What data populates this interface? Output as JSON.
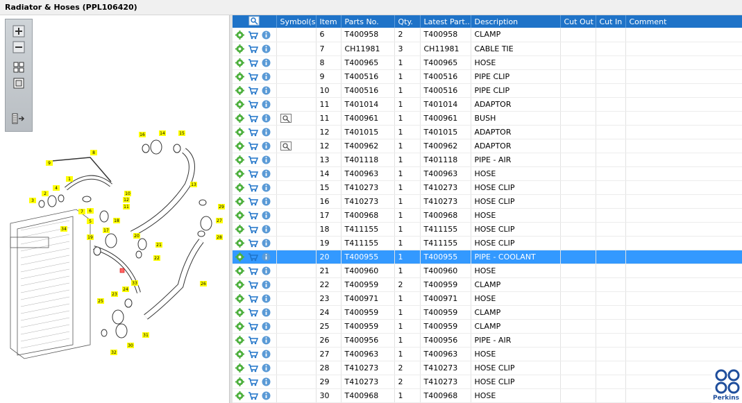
{
  "window": {
    "title": "Radiator & Hoses (PPL106420)"
  },
  "toolbar": {
    "items": [
      {
        "name": "zoom-in-button",
        "icon": "zoom-in-icon"
      },
      {
        "name": "zoom-out-button",
        "icon": "zoom-out-icon"
      },
      {
        "name": "fit-all-button",
        "icon": "fit-all-icon"
      },
      {
        "name": "fit-window-button",
        "icon": "fit-window-icon"
      },
      {
        "name": "export-button",
        "icon": "export-list-icon"
      }
    ]
  },
  "diagram": {
    "callouts": [
      "1",
      "2",
      "3",
      "4",
      "5",
      "6",
      "7",
      "8",
      "9",
      "10",
      "11",
      "12",
      "13",
      "14",
      "15",
      "16",
      "17",
      "18",
      "19",
      "20",
      "21",
      "22",
      "23",
      "24",
      "25",
      "26",
      "27",
      "28",
      "29",
      "30",
      "31",
      "32",
      "33",
      "34"
    ],
    "hotspot_color": "#ffff00",
    "active_marker_color": "#ff6666"
  },
  "table": {
    "header_color": "#1f73c8",
    "selected_color": "#3399ff",
    "columns": [
      "",
      "Symbol(s)",
      "Item",
      "Parts No.",
      "Qty.",
      "Latest Part...",
      "Description",
      "Cut Out",
      "Cut In",
      "Comment"
    ],
    "rows": [
      {
        "symbol": "",
        "item": "6",
        "part_no": "T400958",
        "qty": "2",
        "latest": "T400958",
        "description": "CLAMP",
        "cut_out": "",
        "cut_in": "",
        "comment": ""
      },
      {
        "symbol": "",
        "item": "7",
        "part_no": "CH11981",
        "qty": "3",
        "latest": "CH11981",
        "description": "CABLE TIE",
        "cut_out": "",
        "cut_in": "",
        "comment": ""
      },
      {
        "symbol": "",
        "item": "8",
        "part_no": "T400965",
        "qty": "1",
        "latest": "T400965",
        "description": "HOSE",
        "cut_out": "",
        "cut_in": "",
        "comment": ""
      },
      {
        "symbol": "",
        "item": "9",
        "part_no": "T400516",
        "qty": "1",
        "latest": "T400516",
        "description": "PIPE CLIP",
        "cut_out": "",
        "cut_in": "",
        "comment": ""
      },
      {
        "symbol": "",
        "item": "10",
        "part_no": "T400516",
        "qty": "1",
        "latest": "T400516",
        "description": "PIPE CLIP",
        "cut_out": "",
        "cut_in": "",
        "comment": ""
      },
      {
        "symbol": "",
        "item": "11",
        "part_no": "T401014",
        "qty": "1",
        "latest": "T401014",
        "description": "ADAPTOR",
        "cut_out": "",
        "cut_in": "",
        "comment": ""
      },
      {
        "symbol": "view-icon",
        "item": "11",
        "part_no": "T400961",
        "qty": "1",
        "latest": "T400961",
        "description": "BUSH",
        "cut_out": "",
        "cut_in": "",
        "comment": ""
      },
      {
        "symbol": "",
        "item": "12",
        "part_no": "T401015",
        "qty": "1",
        "latest": "T401015",
        "description": "ADAPTOR",
        "cut_out": "",
        "cut_in": "",
        "comment": ""
      },
      {
        "symbol": "view-icon",
        "item": "12",
        "part_no": "T400962",
        "qty": "1",
        "latest": "T400962",
        "description": "ADAPTOR",
        "cut_out": "",
        "cut_in": "",
        "comment": ""
      },
      {
        "symbol": "",
        "item": "13",
        "part_no": "T401118",
        "qty": "1",
        "latest": "T401118",
        "description": "PIPE - AIR",
        "cut_out": "",
        "cut_in": "",
        "comment": ""
      },
      {
        "symbol": "",
        "item": "14",
        "part_no": "T400963",
        "qty": "1",
        "latest": "T400963",
        "description": "HOSE",
        "cut_out": "",
        "cut_in": "",
        "comment": ""
      },
      {
        "symbol": "",
        "item": "15",
        "part_no": "T410273",
        "qty": "1",
        "latest": "T410273",
        "description": "HOSE CLIP",
        "cut_out": "",
        "cut_in": "",
        "comment": ""
      },
      {
        "symbol": "",
        "item": "16",
        "part_no": "T410273",
        "qty": "1",
        "latest": "T410273",
        "description": "HOSE CLIP",
        "cut_out": "",
        "cut_in": "",
        "comment": ""
      },
      {
        "symbol": "",
        "item": "17",
        "part_no": "T400968",
        "qty": "1",
        "latest": "T400968",
        "description": "HOSE",
        "cut_out": "",
        "cut_in": "",
        "comment": ""
      },
      {
        "symbol": "",
        "item": "18",
        "part_no": "T411155",
        "qty": "1",
        "latest": "T411155",
        "description": "HOSE CLIP",
        "cut_out": "",
        "cut_in": "",
        "comment": ""
      },
      {
        "symbol": "",
        "item": "19",
        "part_no": "T411155",
        "qty": "1",
        "latest": "T411155",
        "description": "HOSE CLIP",
        "cut_out": "",
        "cut_in": "",
        "comment": ""
      },
      {
        "symbol": "",
        "item": "20",
        "part_no": "T400955",
        "qty": "1",
        "latest": "T400955",
        "description": "PIPE - COOLANT",
        "cut_out": "",
        "cut_in": "",
        "comment": "",
        "selected": true
      },
      {
        "symbol": "",
        "item": "21",
        "part_no": "T400960",
        "qty": "1",
        "latest": "T400960",
        "description": "HOSE",
        "cut_out": "",
        "cut_in": "",
        "comment": ""
      },
      {
        "symbol": "",
        "item": "22",
        "part_no": "T400959",
        "qty": "2",
        "latest": "T400959",
        "description": "CLAMP",
        "cut_out": "",
        "cut_in": "",
        "comment": ""
      },
      {
        "symbol": "",
        "item": "23",
        "part_no": "T400971",
        "qty": "1",
        "latest": "T400971",
        "description": "HOSE",
        "cut_out": "",
        "cut_in": "",
        "comment": ""
      },
      {
        "symbol": "",
        "item": "24",
        "part_no": "T400959",
        "qty": "1",
        "latest": "T400959",
        "description": "CLAMP",
        "cut_out": "",
        "cut_in": "",
        "comment": ""
      },
      {
        "symbol": "",
        "item": "25",
        "part_no": "T400959",
        "qty": "1",
        "latest": "T400959",
        "description": "CLAMP",
        "cut_out": "",
        "cut_in": "",
        "comment": ""
      },
      {
        "symbol": "",
        "item": "26",
        "part_no": "T400956",
        "qty": "1",
        "latest": "T400956",
        "description": "PIPE - AIR",
        "cut_out": "",
        "cut_in": "",
        "comment": ""
      },
      {
        "symbol": "",
        "item": "27",
        "part_no": "T400963",
        "qty": "1",
        "latest": "T400963",
        "description": "HOSE",
        "cut_out": "",
        "cut_in": "",
        "comment": ""
      },
      {
        "symbol": "",
        "item": "28",
        "part_no": "T410273",
        "qty": "2",
        "latest": "T410273",
        "description": "HOSE CLIP",
        "cut_out": "",
        "cut_in": "",
        "comment": ""
      },
      {
        "symbol": "",
        "item": "29",
        "part_no": "T410273",
        "qty": "2",
        "latest": "T410273",
        "description": "HOSE CLIP",
        "cut_out": "",
        "cut_in": "",
        "comment": ""
      },
      {
        "symbol": "",
        "item": "30",
        "part_no": "T400968",
        "qty": "1",
        "latest": "T400968",
        "description": "HOSE",
        "cut_out": "",
        "cut_in": "",
        "comment": ""
      }
    ],
    "row_icons": [
      "gear-icon",
      "cart-icon",
      "info-icon"
    ]
  },
  "brand": {
    "name": "Perkins",
    "color": "#1f4e9c"
  }
}
